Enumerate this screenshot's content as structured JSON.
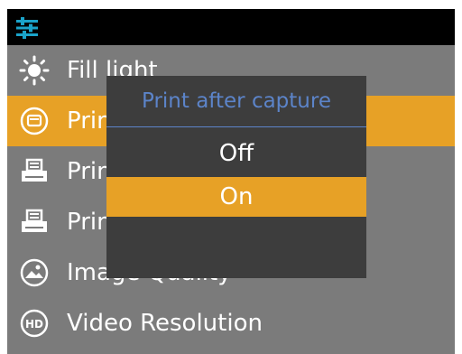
{
  "menu": {
    "items": [
      {
        "label": "Fill light",
        "icon": "sun-icon",
        "selected": false
      },
      {
        "label": "Print after capture",
        "icon": "print-capture-icon",
        "selected": true
      },
      {
        "label": "Print",
        "icon": "printer-icon",
        "selected": false
      },
      {
        "label": "Print",
        "icon": "printer-icon",
        "selected": false
      },
      {
        "label": "Image Quality",
        "icon": "image-quality-icon",
        "selected": false
      },
      {
        "label": "Video Resolution",
        "icon": "hd-icon",
        "selected": false
      }
    ]
  },
  "dialog": {
    "title": "Print after capture",
    "options": [
      {
        "label": "Off",
        "selected": false
      },
      {
        "label": "On",
        "selected": true
      }
    ]
  },
  "colors": {
    "accent": "#e7a126",
    "title_blue": "#5c84c9",
    "menu_bg": "#7b7b7b",
    "dialog_bg": "#3d3d3d",
    "topbar_bg": "#000000",
    "settings_icon": "#1aa3c9"
  }
}
